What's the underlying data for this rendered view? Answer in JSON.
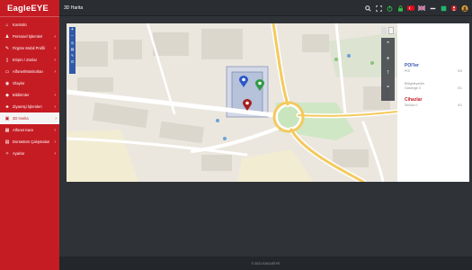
{
  "app": {
    "brand": "EagleEYE",
    "page_title": "3D Harita",
    "footer": "© 2021 EAGLEEYE"
  },
  "sidebar": {
    "items": [
      {
        "label": "Kontrolü",
        "icon": "home-icon",
        "active": false
      },
      {
        "label": "Personel İşlemleri",
        "icon": "users-icon",
        "active": false
      },
      {
        "label": "Firgöre Mobil Profili",
        "icon": "profile-icon",
        "active": false
      },
      {
        "label": "Erişim / Zonlar",
        "icon": "door-icon",
        "active": false
      },
      {
        "label": "Alfonet/Monitorları",
        "icon": "monitor-icon",
        "active": false
      },
      {
        "label": "Olaylar",
        "icon": "alert-icon",
        "active": false
      },
      {
        "label": "Bildirimler",
        "icon": "bell-icon",
        "active": false
      },
      {
        "label": "Ziyaretçi İşlemleri",
        "icon": "visitor-icon",
        "active": false
      },
      {
        "label": "3D Harita",
        "icon": "map-icon",
        "active": true
      },
      {
        "label": "Alfonet Kare",
        "icon": "grid-icon",
        "active": false
      },
      {
        "label": "Donüstüm Çalışmaları",
        "icon": "chart-icon",
        "active": false
      },
      {
        "label": "Ayarlar",
        "icon": "wrench-icon",
        "active": false
      }
    ]
  },
  "topbar": {
    "icons": [
      "search-icon",
      "fullscreen-icon",
      "power-icon",
      "lock-icon",
      "flag-tr-icon",
      "flag-gb-icon",
      "menu-icon",
      "green-square-icon",
      "notification-icon",
      "user-avatar-icon"
    ],
    "accent": "#c51c24"
  },
  "right_panel": {
    "sections": [
      {
        "title": "POI'ler",
        "title_color": "#3a56b5",
        "rows": [
          {
            "label": "POI",
            "value": "0/3"
          }
        ]
      },
      {
        "title": "Bölgeleyiciler",
        "title_color": "#8a8f95",
        "rows": [
          {
            "label": "Gösterge 0",
            "value": "0/1"
          }
        ]
      },
      {
        "title": "Cihazlar",
        "title_color": "#c51c24",
        "rows": [
          {
            "label": "Sensör 0",
            "value": "0/1"
          }
        ]
      }
    ]
  },
  "map": {
    "markers": [
      {
        "name": "blue-marker",
        "color": "#2b58c9"
      },
      {
        "name": "green-marker",
        "color": "#2f9a44"
      },
      {
        "name": "red-marker",
        "color": "#a4201c"
      }
    ]
  }
}
